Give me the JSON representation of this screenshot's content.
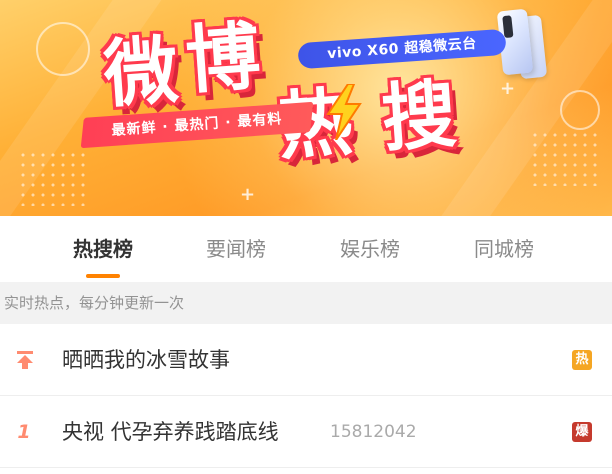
{
  "banner": {
    "title_chars": [
      "微",
      "博",
      "热",
      "搜"
    ],
    "sponsor_text": "vivo X60 超稳微云台",
    "slogan": "最新鲜 · 最热门 · 最有料",
    "colors": {
      "bg": "#ffb036",
      "title_outline": "#ff3a4d",
      "sponsor_bg": "#4a66ff"
    }
  },
  "tabs": [
    {
      "label": "热搜榜",
      "active": true
    },
    {
      "label": "要闻榜",
      "active": false
    },
    {
      "label": "娱乐榜",
      "active": false
    },
    {
      "label": "同城榜",
      "active": false
    }
  ],
  "accent_color": "#ff8200",
  "subheader": "实时热点，每分钟更新一次",
  "list": [
    {
      "rank": "",
      "rank_icon": "pin-top-icon",
      "title": "晒晒我的冰雪故事",
      "count": "",
      "badge": "热",
      "badge_color": "#f5a623"
    },
    {
      "rank": "1",
      "rank_icon": "",
      "title": "央视 代孕弃养践踏底线",
      "count": "15812042",
      "badge": "爆",
      "badge_color": "#c53a2d"
    }
  ]
}
